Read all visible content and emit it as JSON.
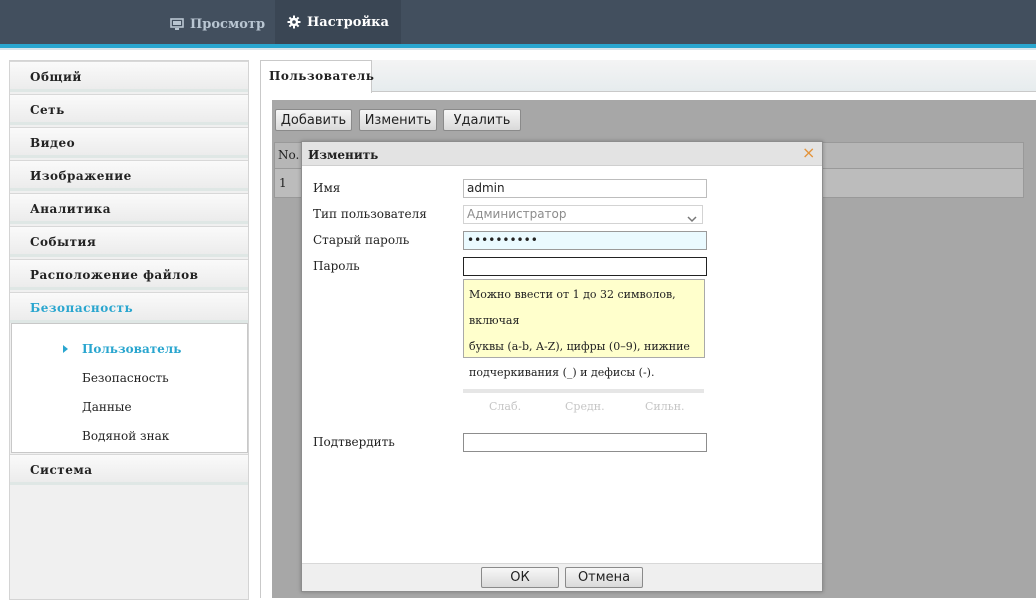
{
  "topnav": {
    "view_label": "Просмотр",
    "settings_label": "Настройка"
  },
  "sidebar": {
    "items": [
      {
        "label": "Общий"
      },
      {
        "label": "Сеть"
      },
      {
        "label": "Видео"
      },
      {
        "label": "Изображение"
      },
      {
        "label": "Аналитика"
      },
      {
        "label": "События"
      },
      {
        "label": "Расположение файлов"
      },
      {
        "label": "Безопасность"
      },
      {
        "label": "Система"
      }
    ],
    "sub_items": [
      {
        "label": "Пользователь"
      },
      {
        "label": "Безопасность"
      },
      {
        "label": "Данные"
      },
      {
        "label": "Водяной знак"
      }
    ]
  },
  "content": {
    "tab_label": "Пользователь",
    "toolbar": {
      "add_label": "Добавить",
      "edit_label": "Изменить",
      "delete_label": "Удалить"
    },
    "table": {
      "col_no": "No.",
      "rows": [
        {
          "no": "1"
        }
      ]
    }
  },
  "dialog": {
    "title": "Изменить",
    "close_glyph": "×",
    "name_label": "Имя",
    "name_value": "admin",
    "user_type_label": "Тип пользователя",
    "user_type_value": "Администратор",
    "old_password_label": "Старый пароль",
    "old_password_value": "••••••••••",
    "password_label": "Пароль",
    "password_value": "",
    "hint_lines": [
      "Можно ввести от 1 до 32 символов, включая",
      "буквы (a-b, A-Z), цифры (0–9), нижние",
      "подчеркивания (_) и дефисы (-)."
    ],
    "strength": {
      "weak": "Слаб.",
      "medium": "Средн.",
      "strong": "Сильн."
    },
    "confirm_label": "Подтвердить",
    "confirm_value": "",
    "ok_label": "ОК",
    "cancel_label": "Отмена"
  },
  "colors": {
    "accent": "#2aa6cf",
    "topbar": "#424f5e",
    "close": "#e3933a",
    "hint_bg": "#ffffcc"
  }
}
